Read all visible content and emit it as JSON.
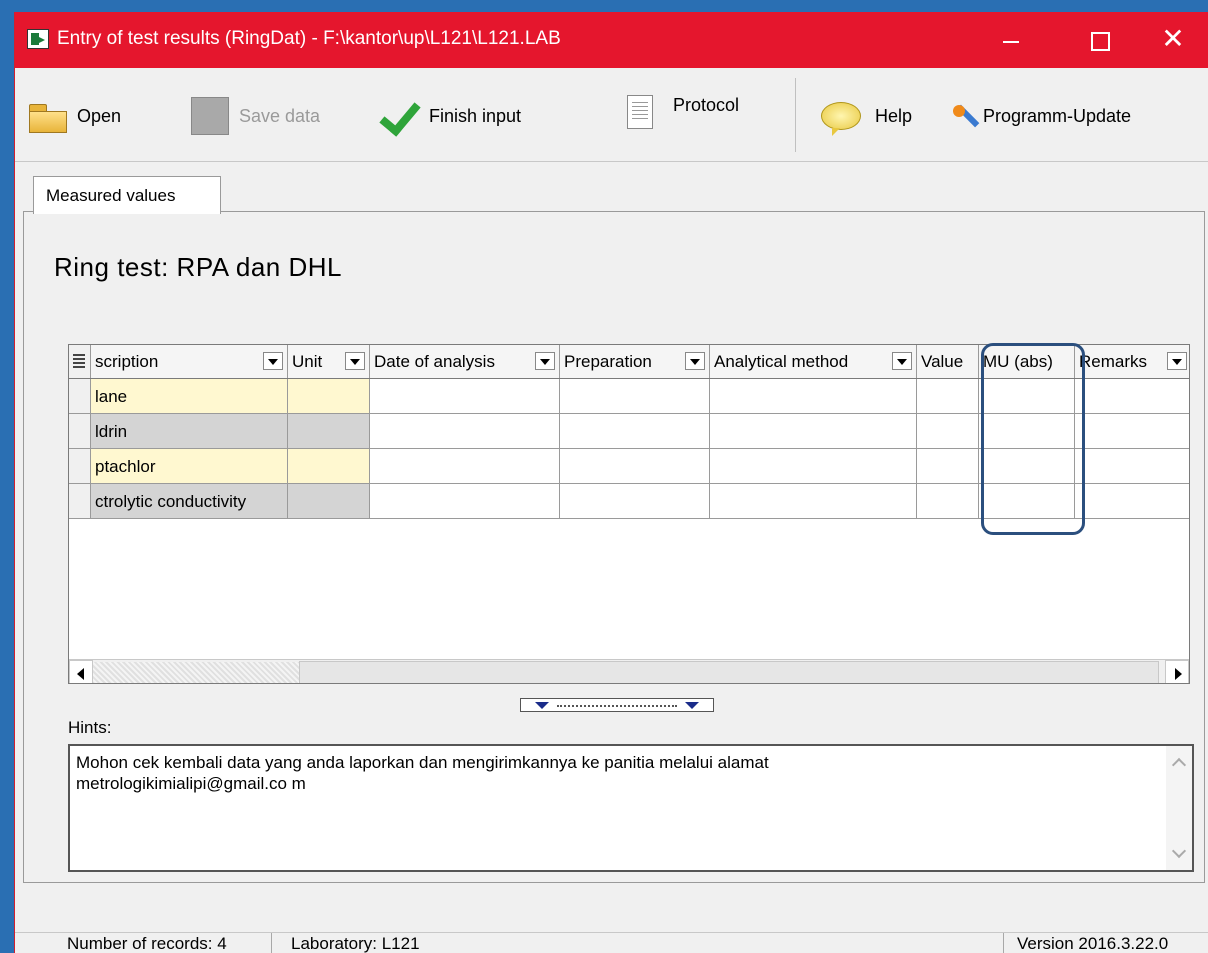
{
  "window": {
    "title": "Entry of test results (RingDat) - F:\\kantor\\up\\L121\\L121.LAB",
    "close_glyph": "✕"
  },
  "toolbar": {
    "open": "Open",
    "save": "Save data",
    "finish": "Finish input",
    "protocol": "Protocol",
    "help": "Help",
    "update": "Programm-Update"
  },
  "tabs": [
    {
      "label": "Measured values"
    }
  ],
  "main": {
    "title": "Ring test: RPA dan DHL"
  },
  "grid": {
    "columns": [
      "scription",
      "Unit",
      "Date of analysis",
      "Preparation",
      "Analytical method",
      "Value",
      "MU (abs)",
      "Remarks"
    ],
    "rows": [
      {
        "description": "lane",
        "unit": "",
        "style": "yellow"
      },
      {
        "description": "ldrin",
        "unit": "",
        "style": "gray"
      },
      {
        "description": "ptachlor",
        "unit": "",
        "style": "yellow"
      },
      {
        "description": "ctrolytic conductivity",
        "unit": "",
        "style": "gray"
      }
    ]
  },
  "hints": {
    "label": "Hints:",
    "text_line1": "Mohon cek kembali data  yang anda laporkan dan  mengirimkannya ke panitia  melalui  alamat",
    "text_line2": "metrologikimialipi@gmail.co m"
  },
  "status": {
    "records": "Number of records: 4",
    "laboratory": "Laboratory: L121",
    "version": "Version 2016.3.22.0"
  },
  "colors": {
    "titlebar": "#e5162d",
    "highlight_box": "#2b4f7e",
    "yellow_cell": "#fff8d0",
    "gray_cell": "#d4d4d4"
  }
}
